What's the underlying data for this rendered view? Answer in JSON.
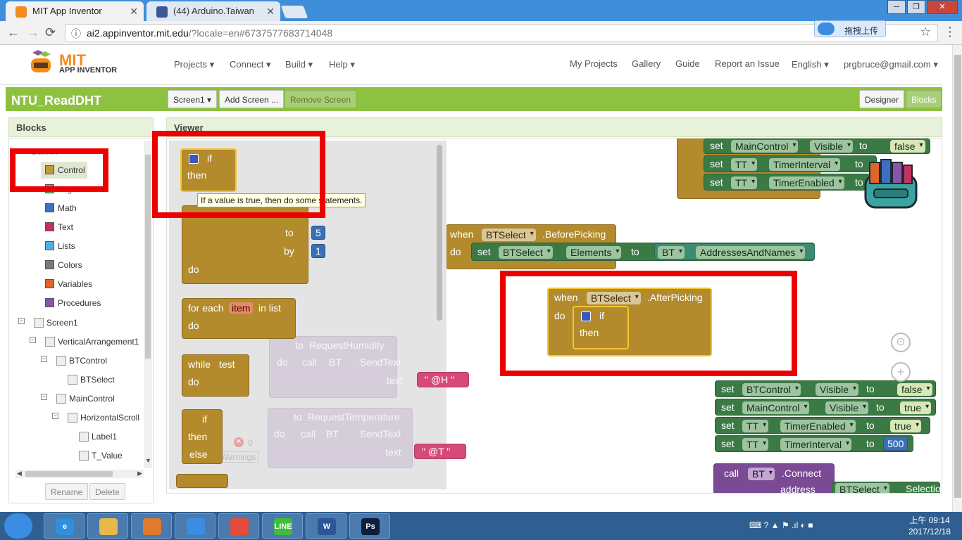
{
  "browser": {
    "tabs": [
      {
        "title": "MIT App Inventor",
        "active": true
      },
      {
        "title": "(44) Arduino.Taiwan",
        "active": false
      }
    ],
    "url_host": "ai2.appinventor.mit.edu",
    "url_rest": "/?locale=en#6737577683714048",
    "extension_label": "拖拽上传",
    "nav": {
      "back": "←",
      "forward": "→",
      "reload": "⟳",
      "info": "ⓘ",
      "star": "☆",
      "menu": "⋮"
    },
    "window_controls": {
      "minimize": "─",
      "restore": "❐",
      "close": "✕"
    },
    "tab_close": "✕"
  },
  "app": {
    "logo_top": "MIT",
    "logo_bottom": "APP INVENTOR",
    "menu_left": [
      "Projects ▾",
      "Connect ▾",
      "Build ▾",
      "Help ▾"
    ],
    "menu_right": [
      "My Projects",
      "Gallery",
      "Guide",
      "Report an Issue",
      "English ▾",
      "prgbruce@gmail.com ▾"
    ],
    "project_name": "NTU_ReadDHT",
    "screen_select": "Screen1 ▾",
    "add_screen": "Add Screen ...",
    "remove_screen": "Remove Screen",
    "designer": "Designer",
    "blocks": "Blocks"
  },
  "blocks_panel": {
    "title": "Blocks",
    "builtin_label": "Built-in",
    "builtin": [
      {
        "label": "Control",
        "color": "#c49a39"
      },
      {
        "label": "Logic",
        "color": "#6aa84f"
      },
      {
        "label": "Math",
        "color": "#3f6fc1"
      },
      {
        "label": "Text",
        "color": "#c0345f"
      },
      {
        "label": "Lists",
        "color": "#4eb2e6"
      },
      {
        "label": "Colors",
        "color": "#7a7a7a"
      },
      {
        "label": "Variables",
        "color": "#e0652b"
      },
      {
        "label": "Procedures",
        "color": "#8a54a8"
      }
    ],
    "tree": [
      "Screen1",
      "VerticalArrangement1",
      "BTControl",
      "BTSelect",
      "MainControl",
      "HorizontalScroll",
      "Label1",
      "T_Value"
    ],
    "rename": "Rename",
    "delete": "Delete",
    "tree_toggle": "−",
    "scroll_up": "▲",
    "scroll_down": "▼",
    "scroll_left": "◀",
    "scroll_right": "▶"
  },
  "viewer": {
    "title": "Viewer",
    "tooltip": "If a value is true, then do some statements.",
    "flyout": {
      "if": "if",
      "then": "then",
      "to": "to",
      "by": "by",
      "do": "do",
      "for_each": "for each",
      "item": "item",
      "in_list": "in list",
      "while": "while",
      "test": "test",
      "else": "else",
      "num_to": "5",
      "num_by": "1"
    },
    "ghost": {
      "to1": "to",
      "proc1": "RequestHumidity",
      "to2": "to",
      "proc2": "RequestTemperature",
      "call": "call",
      "bt": "BT",
      "sendtext": ".SendText",
      "text": "text",
      "str_h": "\" @H \"",
      "str_t": "\" @T \"",
      "warnings_count": "0",
      "warnings": "Warnings",
      "do": "do"
    },
    "top_blocks": {
      "set": "set",
      "maincontrol": "MainControl",
      "visible": "Visible",
      "to": "to",
      "false": "false",
      "tt": "TT",
      "timerinterval": "TimerInterval",
      "timerenabled": "TimerEnabled"
    },
    "before_picking": {
      "when": "when",
      "component": "BTSelect",
      "event": ".BeforePicking",
      "do": "do",
      "set": "set",
      "elements": "Elements",
      "to": "to",
      "bt": "BT",
      "addresses": "AddressesAndNames"
    },
    "after_picking": {
      "when": "when",
      "component": "BTSelect",
      "event": ".AfterPicking",
      "do": "do",
      "if": "if",
      "then": "then"
    },
    "setters": {
      "set": "set",
      "to": "to",
      "btcontrol": "BTControl",
      "visible": "Visible",
      "false": "false",
      "maincontrol": "MainControl",
      "true": "true",
      "tt": "TT",
      "timerenabled": "TimerEnabled",
      "timerinterval": "TimerInterval",
      "value_500": "500"
    },
    "connect": {
      "call": "call",
      "bt": "BT",
      "method": ".Connect",
      "address": "address",
      "btselect": "BTSelect",
      "selection": "Selection"
    },
    "workspace_controls": {
      "center": "⊙",
      "zoom_in": "+"
    }
  },
  "taskbar": {
    "time": "上午 09:14",
    "date": "2017/12/18",
    "apps": [
      "Internet Explorer",
      "File Explorer",
      "Media Player",
      "Baidu Cloud",
      "Chrome",
      "LINE",
      "Word",
      "Photoshop"
    ],
    "app_glyphs": [
      "e",
      "",
      "",
      "",
      "",
      "LINE",
      "W",
      "Ps"
    ],
    "tray_icons": "⌨ ? ▲ ⚑ .ıl ◐ ■"
  },
  "colors": {
    "green_bar": "#8dc140",
    "control": "#b38b2d",
    "highlight_box": "#ee0000"
  }
}
